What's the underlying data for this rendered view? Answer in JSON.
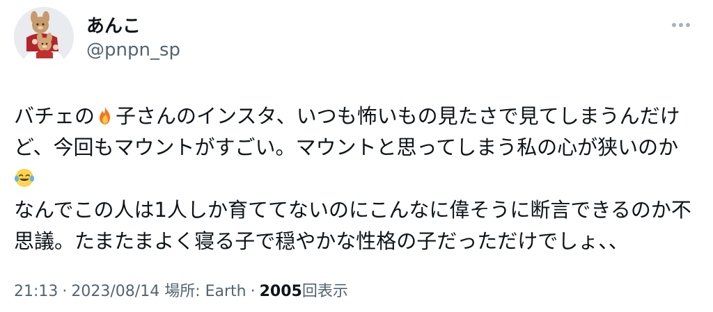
{
  "user": {
    "display_name": "あんこ",
    "handle": "@pnpn_sp",
    "avatar_icon": "teddy-bear-avatar-icon"
  },
  "menu": {
    "more_icon": "more-horizontal-icon"
  },
  "tweet": {
    "line1_a": "バチェの",
    "line1_b": "子さんのインスタ、いつも怖いもの見たさで見てしまうんだけ",
    "line2": "ど、今回もマウントがすごい。マウントと思ってしまう私の心が狭いのか",
    "line4": "なんでこの人は1人しか育ててないのにこんなに偉そうに断言できるのか不",
    "line5": "思議。たまたまよく寝る子で穏やかな性格の子だっただけでしょ、、",
    "emoji_fire": "fire-emoji-icon",
    "emoji_laugh": "face-with-tears-of-joy-emoji-icon"
  },
  "meta": {
    "time": "21:13",
    "date": "2023/08/14",
    "location": "場所: Earth",
    "separator": "·",
    "views_count": "2005",
    "views_label": "回表示"
  }
}
